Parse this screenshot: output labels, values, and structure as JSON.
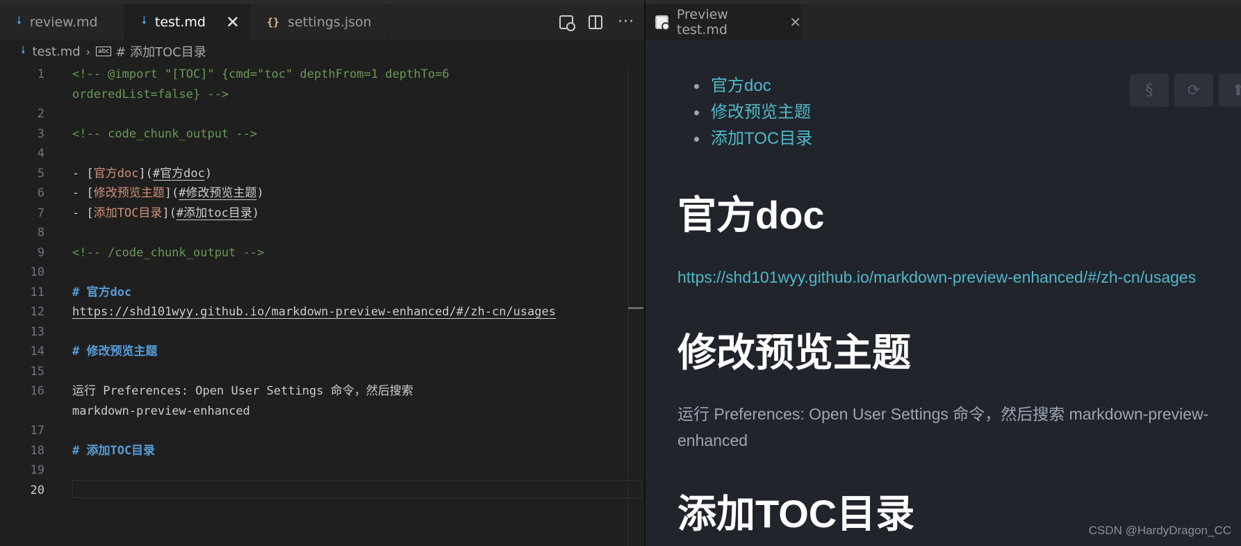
{
  "editor": {
    "tabs": [
      {
        "label": "review.md",
        "icon": "markdown-icon",
        "active": false
      },
      {
        "label": "test.md",
        "icon": "markdown-icon",
        "active": true
      },
      {
        "label": "settings.json",
        "icon": "json-icon",
        "active": false
      }
    ],
    "close_glyph": "✕",
    "actions": [
      "open-preview-icon",
      "split-editor-icon",
      "more-actions-icon"
    ],
    "more_glyph": "···",
    "breadcrumb": {
      "file": "test.md",
      "separator": "›",
      "symbol_glyph": "abc",
      "heading": "# 添加TOC目录"
    },
    "lines": [
      {
        "n": "1",
        "parts": [
          {
            "t": "<!-- @import \"[TOC]\" {cmd=\"toc\" depthFrom=1 depthTo=6",
            "c": "comment"
          }
        ]
      },
      {
        "n": "",
        "parts": [
          {
            "t": "orderedList=false} -->",
            "c": "comment"
          }
        ]
      },
      {
        "n": "2",
        "parts": []
      },
      {
        "n": "3",
        "parts": [
          {
            "t": "<!-- code_chunk_output -->",
            "c": "comment"
          }
        ]
      },
      {
        "n": "4",
        "parts": []
      },
      {
        "n": "5",
        "parts": [
          {
            "t": "- [",
            "c": "punct"
          },
          {
            "t": "官方doc",
            "c": "linktext"
          },
          {
            "t": "](",
            "c": "punct"
          },
          {
            "t": "#官方doc",
            "c": "url"
          },
          {
            "t": ")",
            "c": "punct"
          }
        ]
      },
      {
        "n": "6",
        "parts": [
          {
            "t": "- [",
            "c": "punct"
          },
          {
            "t": "修改预览主题",
            "c": "linktext"
          },
          {
            "t": "](",
            "c": "punct"
          },
          {
            "t": "#修改预览主题",
            "c": "url"
          },
          {
            "t": ")",
            "c": "punct"
          }
        ]
      },
      {
        "n": "7",
        "parts": [
          {
            "t": "- [",
            "c": "punct"
          },
          {
            "t": "添加TOC目录",
            "c": "linktext"
          },
          {
            "t": "](",
            "c": "punct"
          },
          {
            "t": "#添加toc目录",
            "c": "url"
          },
          {
            "t": ")",
            "c": "punct"
          }
        ]
      },
      {
        "n": "8",
        "parts": []
      },
      {
        "n": "9",
        "parts": [
          {
            "t": "<!-- /code_chunk_output -->",
            "c": "comment"
          }
        ]
      },
      {
        "n": "10",
        "parts": []
      },
      {
        "n": "11",
        "parts": [
          {
            "t": "# 官方doc",
            "c": "head"
          }
        ]
      },
      {
        "n": "12",
        "parts": [
          {
            "t": "https://shd101wyy.github.io/markdown-preview-enhanced/#/zh-cn/usages",
            "c": "url"
          }
        ]
      },
      {
        "n": "13",
        "parts": []
      },
      {
        "n": "14",
        "parts": [
          {
            "t": "# 修改预览主题",
            "c": "head"
          }
        ]
      },
      {
        "n": "15",
        "parts": []
      },
      {
        "n": "16",
        "parts": [
          {
            "t": "运行 Preferences: Open User Settings 命令，然后搜索",
            "c": "punct"
          }
        ]
      },
      {
        "n": "",
        "parts": [
          {
            "t": "markdown-preview-enhanced",
            "c": "punct"
          }
        ]
      },
      {
        "n": "17",
        "parts": []
      },
      {
        "n": "18",
        "parts": [
          {
            "t": "# 添加TOC目录",
            "c": "head"
          }
        ]
      },
      {
        "n": "19",
        "parts": []
      },
      {
        "n": "20",
        "parts": [],
        "current": true
      }
    ]
  },
  "preview": {
    "tab_label": "Preview test.md",
    "tab_icon": "preview-icon",
    "close_glyph": "✕",
    "toolbar": [
      {
        "glyph": "§",
        "icon": "sync-source-icon"
      },
      {
        "glyph": "⟳",
        "icon": "refresh-icon"
      },
      {
        "glyph": "⬆",
        "icon": "back-to-top-icon"
      }
    ],
    "toc": [
      "官方doc",
      "修改预览主题",
      "添加TOC目录"
    ],
    "sections": {
      "h1_official": "官方doc",
      "link": "https://shd101wyy.github.io/markdown-preview-enhanced/#/zh-cn/usages",
      "h1_theme": "修改预览主题",
      "para": "运行 Preferences: Open User Settings 命令，然后搜索 markdown-preview-enhanced",
      "h1_toc": "添加TOC目录"
    },
    "watermark": "CSDN @HardyDragon_CC"
  },
  "colors": {
    "comment": "#6a9955",
    "heading": "#569cd6",
    "linktext": "#ce9178",
    "preview_link": "#4fb8c9"
  }
}
